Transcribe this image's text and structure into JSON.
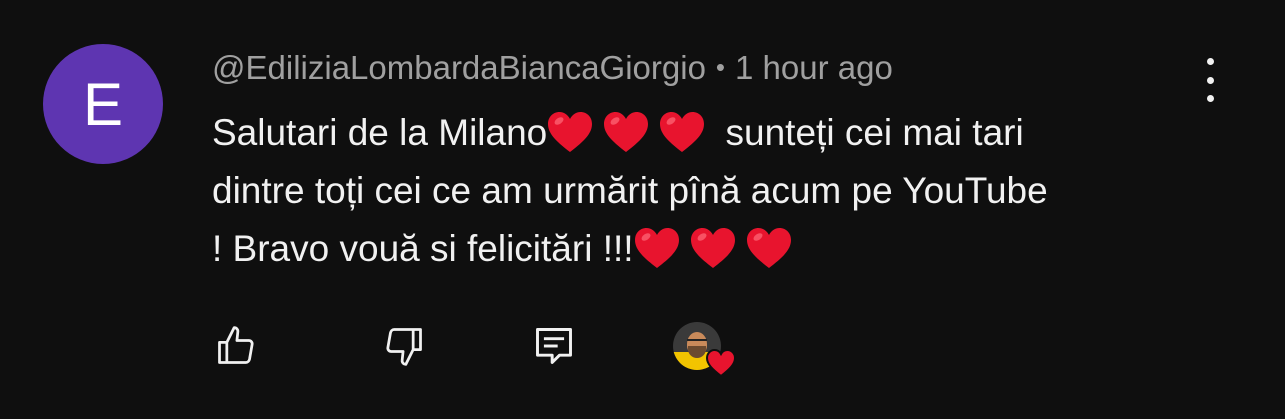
{
  "comment": {
    "avatar_letter": "E",
    "avatar_color": "#5e35b1",
    "author": "@EdiliziaLombardaBiancaGiorgio",
    "separator": "•",
    "time": "1 hour ago",
    "text_part1": "Salutari de la Milano",
    "text_part2": " sunteți cei mai tari\ndintre toți cei ce am urmărit pînă acum pe YouTube\n! Bravo vouă si felicitări !!!",
    "heart_emoji": "❤️"
  },
  "actions": {
    "like_icon": "thumbs-up-icon",
    "dislike_icon": "thumbs-down-icon",
    "reply_icon": "reply-comment-icon",
    "creator_heart_icon": "creator-heart-icon"
  },
  "colors": {
    "background": "#0f0f0f",
    "text": "#f1f1f1",
    "meta": "#a0a0a0",
    "heart": "#e8142e"
  }
}
